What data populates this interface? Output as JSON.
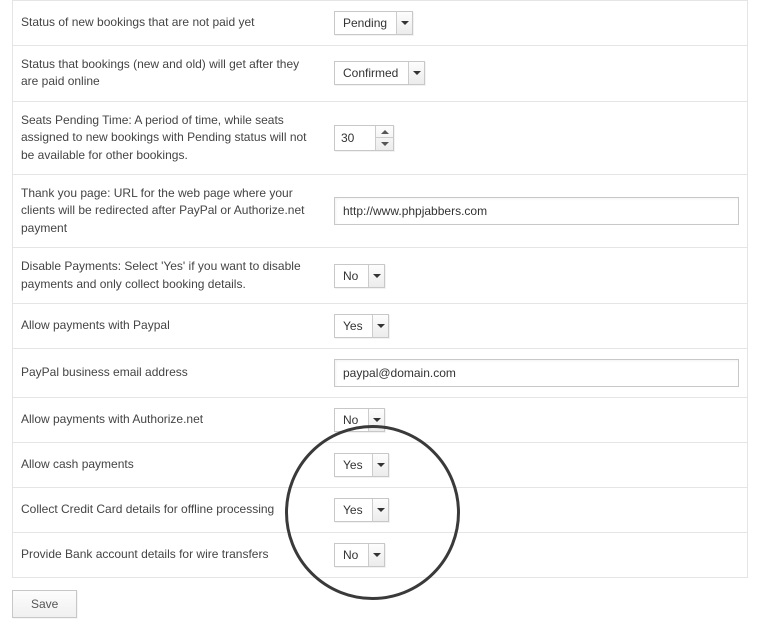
{
  "rows": {
    "status_unpaid": {
      "label": "Status of new bookings that are not paid yet",
      "value": "Pending"
    },
    "status_paid": {
      "label": "Status that bookings (new and old) will get after they are paid online",
      "value": "Confirmed"
    },
    "seats_pending": {
      "label": "Seats Pending Time:\nA period of time, while seats assigned to new bookings with Pending status will not be available for other bookings.",
      "value": "30"
    },
    "thankyou": {
      "label": "Thank you page:\nURL for the web page where your clients will be redirected after PayPal or Authorize.net payment",
      "value": "http://www.phpjabbers.com"
    },
    "disable_pay": {
      "label": "Disable Payments:\nSelect 'Yes' if you want to disable payments and only collect booking details.",
      "value": "No"
    },
    "allow_paypal": {
      "label": "Allow payments with Paypal",
      "value": "Yes"
    },
    "paypal_email": {
      "label": "PayPal business email address",
      "value": "paypal@domain.com"
    },
    "allow_authnet": {
      "label": "Allow payments with Authorize.net",
      "value": "No"
    },
    "allow_cash": {
      "label": "Allow cash payments",
      "value": "Yes"
    },
    "collect_cc": {
      "label": "Collect Credit Card details for offline processing",
      "value": "Yes"
    },
    "bank_wire": {
      "label": "Provide Bank account details for wire transfers",
      "value": "No"
    }
  },
  "save_label": "Save"
}
